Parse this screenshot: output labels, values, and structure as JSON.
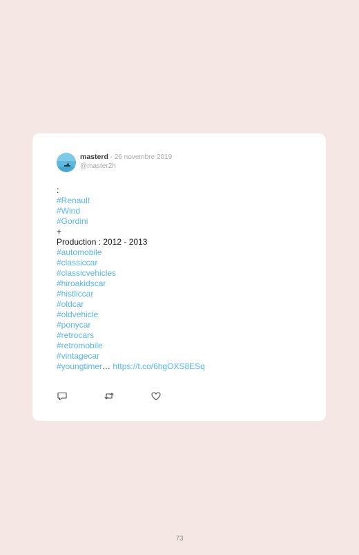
{
  "tweet": {
    "author_name": "masterd",
    "separator": " · ",
    "date": "26 novembre 2019",
    "handle": "@master2h",
    "lines": [
      {
        "text": ":",
        "type": "plain"
      },
      {
        "text": "#Renault",
        "type": "tag"
      },
      {
        "text": "#Wind",
        "type": "tag"
      },
      {
        "text": "#Gordini",
        "type": "tag"
      },
      {
        "text": "+",
        "type": "plain"
      },
      {
        "text": "Production : 2012 - 2013",
        "type": "plain"
      },
      {
        "text": "#automobile",
        "type": "tag"
      },
      {
        "text": "#classiccar",
        "type": "tag"
      },
      {
        "text": "#classicvehicles",
        "type": "tag"
      },
      {
        "text": "#hiroakidscar",
        "type": "tag"
      },
      {
        "text": "#histliccar",
        "type": "tag"
      },
      {
        "text": "#oldcar",
        "type": "tag"
      },
      {
        "text": "#oldvehicle",
        "type": "tag"
      },
      {
        "text": "#ponycar",
        "type": "tag"
      },
      {
        "text": "#retrocars",
        "type": "tag"
      },
      {
        "text": "#retromobile",
        "type": "tag"
      },
      {
        "text": "#vintagecar",
        "type": "tag"
      }
    ],
    "last_tag": "#youngtimer",
    "ellipsis": "…",
    "link": "https://t.co/6hgOXS8ESq"
  },
  "actions": {
    "icons": [
      "reply-icon",
      "retweet-icon",
      "like-icon"
    ]
  },
  "page_number": "73",
  "colors": {
    "background": "#f4e7e4",
    "card": "#ffffff",
    "accent": "#57b6e6",
    "muted": "#a8a8a8"
  }
}
